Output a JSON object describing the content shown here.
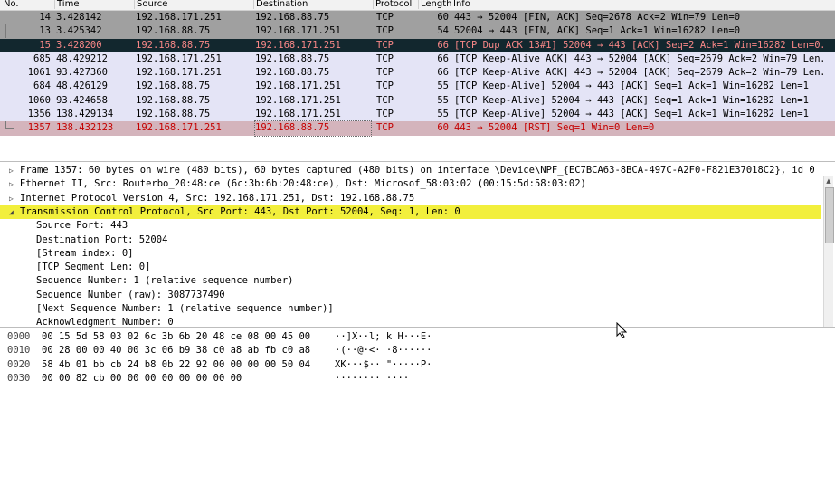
{
  "columns": [
    "No.",
    "Time",
    "Source",
    "Destination",
    "Protocol",
    "Length",
    "Info"
  ],
  "packets": [
    {
      "no": "14",
      "time": "3.428142",
      "src": "192.168.171.251",
      "dst": "192.168.88.75",
      "proto": "TCP",
      "len": "60",
      "info": "443 → 52004 [FIN, ACK] Seq=2678 Ack=2 Win=79 Len=0"
    },
    {
      "no": "13",
      "time": "3.425342",
      "src": "192.168.88.75",
      "dst": "192.168.171.251",
      "proto": "TCP",
      "len": "54",
      "info": "52004 → 443 [FIN, ACK] Seq=1 Ack=1 Win=16282 Len=0"
    },
    {
      "no": "15",
      "time": "3.428200",
      "src": "192.168.88.75",
      "dst": "192.168.171.251",
      "proto": "TCP",
      "len": "66",
      "info": "[TCP Dup ACK 13#1] 52004 → 443 [ACK] Seq=2 Ack=1 Win=16282 Len=0…"
    },
    {
      "no": "685",
      "time": "48.429212",
      "src": "192.168.171.251",
      "dst": "192.168.88.75",
      "proto": "TCP",
      "len": "66",
      "info": "[TCP Keep-Alive ACK] 443 → 52004 [ACK] Seq=2679 Ack=2 Win=79 Len…"
    },
    {
      "no": "1061",
      "time": "93.427360",
      "src": "192.168.171.251",
      "dst": "192.168.88.75",
      "proto": "TCP",
      "len": "66",
      "info": "[TCP Keep-Alive ACK] 443 → 52004 [ACK] Seq=2679 Ack=2 Win=79 Len…"
    },
    {
      "no": "684",
      "time": "48.426129",
      "src": "192.168.88.75",
      "dst": "192.168.171.251",
      "proto": "TCP",
      "len": "55",
      "info": "[TCP Keep-Alive] 52004 → 443 [ACK] Seq=1 Ack=1 Win=16282 Len=1"
    },
    {
      "no": "1060",
      "time": "93.424658",
      "src": "192.168.88.75",
      "dst": "192.168.171.251",
      "proto": "TCP",
      "len": "55",
      "info": "[TCP Keep-Alive] 52004 → 443 [ACK] Seq=1 Ack=1 Win=16282 Len=1"
    },
    {
      "no": "1356",
      "time": "138.429134",
      "src": "192.168.88.75",
      "dst": "192.168.171.251",
      "proto": "TCP",
      "len": "55",
      "info": "[TCP Keep-Alive] 52004 → 443 [ACK] Seq=1 Ack=1 Win=16282 Len=1"
    },
    {
      "no": "1357",
      "time": "138.432123",
      "src": "192.168.171.251",
      "dst": "192.168.88.75",
      "proto": "TCP",
      "len": "60",
      "info": "443 → 52004 [RST] Seq=1 Win=0 Len=0"
    }
  ],
  "details": [
    {
      "text": "Frame 1357: 60 bytes on wire (480 bits), 60 bytes captured (480 bits) on interface \\Device\\NPF_{EC7BCA63-8BCA-497C-A2F0-F821E37018C2}, id 0",
      "arrow": "▷"
    },
    {
      "text": "Ethernet II, Src: Routerbo_20:48:ce (6c:3b:6b:20:48:ce), Dst: Microsof_58:03:02 (00:15:5d:58:03:02)",
      "arrow": "▷"
    },
    {
      "text": "Internet Protocol Version 4, Src: 192.168.171.251, Dst: 192.168.88.75",
      "arrow": "▷"
    },
    {
      "text": "Transmission Control Protocol, Src Port: 443, Dst Port: 52004, Seq: 1, Len: 0",
      "arrow": "◢"
    }
  ],
  "tcp_fields": [
    "Source Port: 443",
    "Destination Port: 52004",
    "[Stream index: 0]",
    "[TCP Segment Len: 0]",
    "Sequence Number: 1    (relative sequence number)",
    "Sequence Number (raw): 3087737490",
    "[Next Sequence Number: 1    (relative sequence number)]",
    "Acknowledgment Number: 0"
  ],
  "bytes": [
    {
      "offset": "0000",
      "hex": "00 15 5d 58 03 02 6c 3b  6b 20 48 ce 08 00 45 00",
      "ascii": "··]X··l; k H···E·"
    },
    {
      "offset": "0010",
      "hex": "00 28 00 00 40 00 3c 06  b9 38 c0 a8 ab fb c0 a8",
      "ascii": "·(··@·<· ·8······"
    },
    {
      "offset": "0020",
      "hex": "58 4b 01 bb cb 24 b8 0b  22 92 00 00 00 00 50 04",
      "ascii": "XK···$·· \"·····P·"
    },
    {
      "offset": "0030",
      "hex": "00 00 82 cb 00 00 00 00  00 00 00 00",
      "ascii": "········ ····"
    }
  ]
}
